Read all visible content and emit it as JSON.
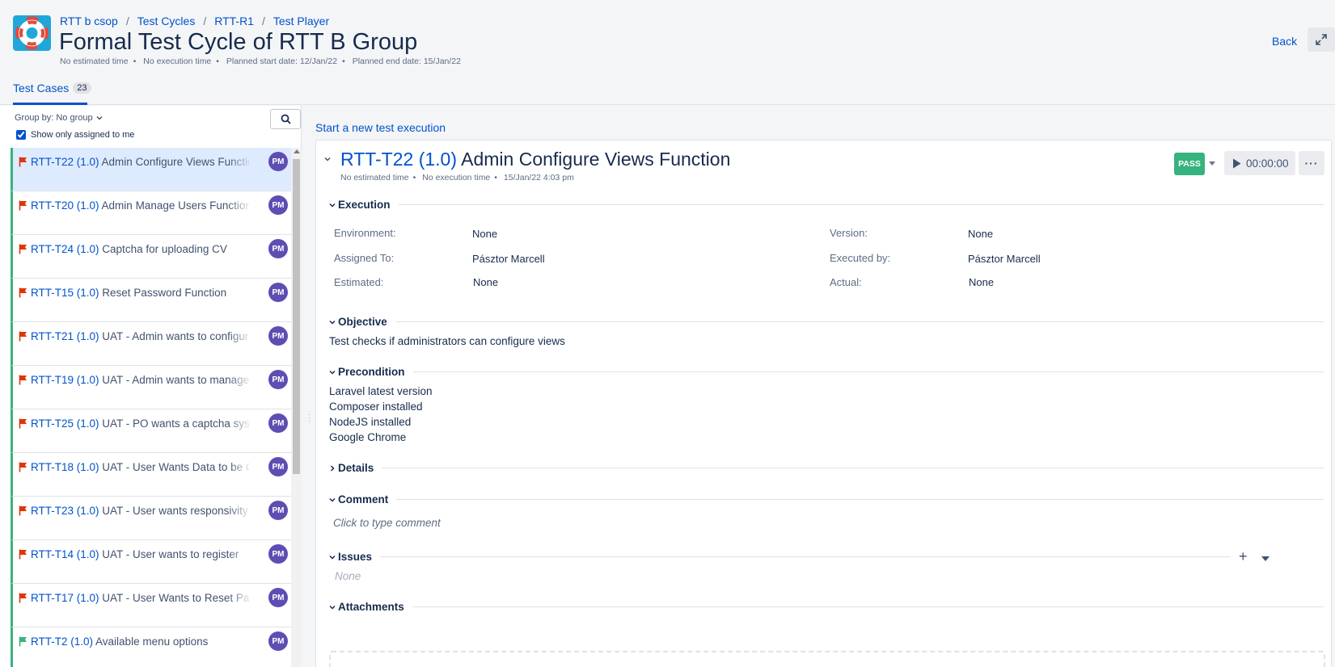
{
  "header": {
    "breadcrumb": [
      "RTT b csop",
      "Test Cycles",
      "RTT-R1",
      "Test Player"
    ],
    "title": "Formal Test Cycle of RTT B Group",
    "meta": [
      "No estimated time",
      "No execution time",
      "Planned start date: 12/Jan/22",
      "Planned end date: 15/Jan/22"
    ],
    "back_label": "Back",
    "tab_label": "Test Cases",
    "tab_count": "23"
  },
  "left": {
    "group_by": "Group by: No group",
    "show_only": "Show only assigned to me",
    "show_only_checked": true,
    "items": [
      {
        "key": "RTT-T22 (1.0)",
        "name": "Admin Configure Views Function",
        "avatar": "PM",
        "flag": "#de350b",
        "active": true
      },
      {
        "key": "RTT-T20 (1.0)",
        "name": "Admin Manage Users Function",
        "avatar": "PM",
        "flag": "#de350b",
        "active": false
      },
      {
        "key": "RTT-T24 (1.0)",
        "name": "Captcha for uploading CV",
        "avatar": "PM",
        "flag": "#de350b",
        "active": false
      },
      {
        "key": "RTT-T15 (1.0)",
        "name": "Reset Password Function",
        "avatar": "PM",
        "flag": "#de350b",
        "active": false
      },
      {
        "key": "RTT-T21 (1.0)",
        "name": "UAT - Admin wants to configure",
        "avatar": "PM",
        "flag": "#de350b",
        "active": false
      },
      {
        "key": "RTT-T19 (1.0)",
        "name": "UAT - Admin wants to manage u",
        "avatar": "PM",
        "flag": "#de350b",
        "active": false
      },
      {
        "key": "RTT-T25 (1.0)",
        "name": "UAT - PO wants a captcha system",
        "avatar": "PM",
        "flag": "#de350b",
        "active": false
      },
      {
        "key": "RTT-T18 (1.0)",
        "name": "UAT - User Wants Data to be GD",
        "avatar": "PM",
        "flag": "#de350b",
        "active": false
      },
      {
        "key": "RTT-T23 (1.0)",
        "name": "UAT - User wants responsivity fo",
        "avatar": "PM",
        "flag": "#de350b",
        "active": false
      },
      {
        "key": "RTT-T14 (1.0)",
        "name": "UAT - User wants to register",
        "avatar": "PM",
        "flag": "#de350b",
        "active": false
      },
      {
        "key": "RTT-T17 (1.0)",
        "name": "UAT - User Wants to Reset Passw",
        "avatar": "PM",
        "flag": "#de350b",
        "active": false
      },
      {
        "key": "RTT-T2 (1.0)",
        "name": "Available menu options",
        "avatar": "PM",
        "flag": "#36b37e",
        "active": false
      }
    ]
  },
  "main": {
    "start_link": "Start a new test execution",
    "case_key": "RTT-T22 (1.0)",
    "case_name": "Admin Configure Views Function",
    "case_meta": [
      "No estimated time",
      "No execution time",
      "15/Jan/22 4:03 pm"
    ],
    "status": "PASS",
    "timer": "00:00:00",
    "more": "···",
    "sections": {
      "execution": "Execution",
      "objective": "Objective",
      "precondition": "Precondition",
      "details": "Details",
      "comment": "Comment",
      "issues": "Issues",
      "attachments": "Attachments"
    },
    "fields": {
      "environment_label": "Environment:",
      "environment_value": "None",
      "version_label": "Version:",
      "version_value": "None",
      "assigned_label": "Assigned To:",
      "assigned_value": "Pásztor Marcell",
      "executed_label": "Executed by:",
      "executed_value": "Pásztor Marcell",
      "estimated_label": "Estimated:",
      "estimated_value": "None",
      "actual_label": "Actual:",
      "actual_value": "None"
    },
    "objective_text": "Test checks if administrators can configure views",
    "precondition_lines": [
      "Laravel latest version",
      "Composer installed",
      "NodeJS installed",
      "Google Chrome"
    ],
    "comment_placeholder": "Click to type comment",
    "issues_none": "None",
    "issues_add": "+"
  }
}
